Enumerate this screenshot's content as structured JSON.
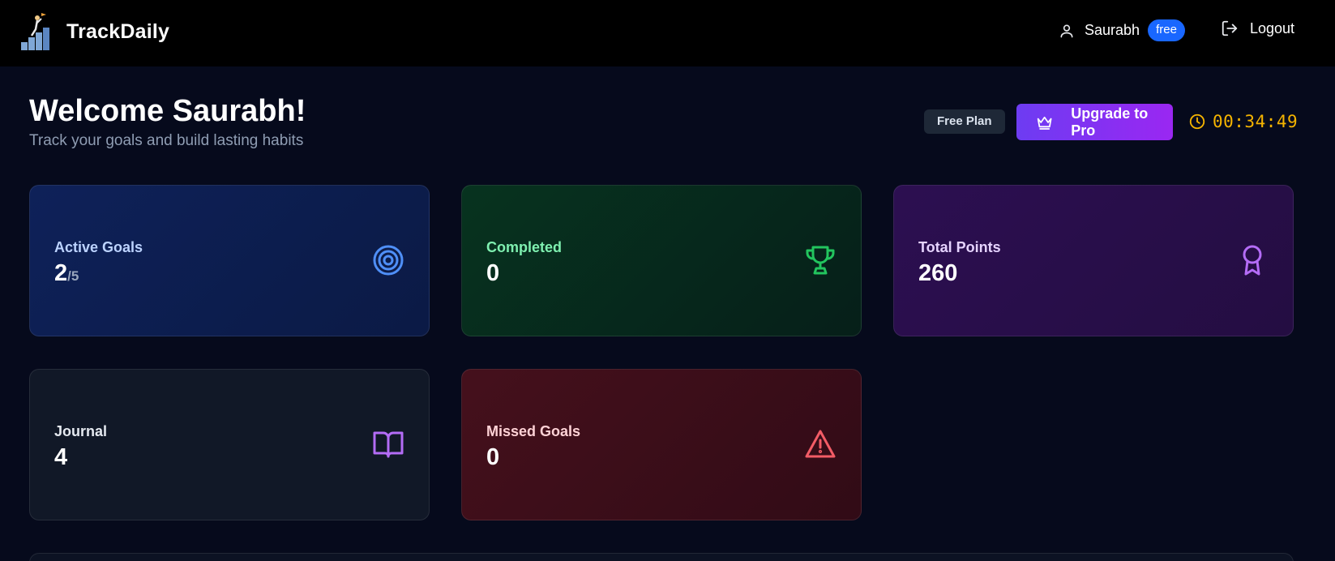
{
  "header": {
    "brand": "TrackDaily",
    "user_name": "Saurabh",
    "tier": "free",
    "logout_label": "Logout"
  },
  "welcome": {
    "title": "Welcome Saurabh!",
    "subtitle": "Track your goals and build lasting habits"
  },
  "plan": {
    "badge": "Free Plan",
    "upgrade_label": "Upgrade to Pro",
    "timer": "00:34:49"
  },
  "stats": {
    "active_goals": {
      "label": "Active Goals",
      "value": "2",
      "max": "/5",
      "icon": "target-icon",
      "color": "#4f8ff7"
    },
    "completed": {
      "label": "Completed",
      "value": "0",
      "icon": "trophy-icon",
      "color": "#22c55e"
    },
    "total_points": {
      "label": "Total Points",
      "value": "260",
      "icon": "award-icon",
      "color": "#b46cf6"
    },
    "journal": {
      "label": "Journal",
      "value": "4",
      "icon": "book-open-icon",
      "color": "#b46cf6"
    },
    "missed_goals": {
      "label": "Missed Goals",
      "value": "0",
      "icon": "alert-triangle-icon",
      "color": "#f25c66"
    }
  }
}
